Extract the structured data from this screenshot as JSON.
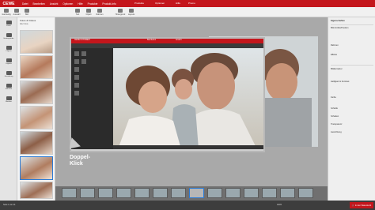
{
  "app": {
    "logo": "CEWE"
  },
  "menubar": {
    "items": [
      "Datei",
      "Bearbeiten",
      "Ansicht",
      "Optionen",
      "Hilfe",
      "Produkte",
      "Produkt-Info"
    ],
    "right_items": [
      "Produkte",
      "Optionen",
      "Hilfe",
      "Promo"
    ]
  },
  "toolbar": {
    "buttons": [
      "Ganzseitig",
      "Auswahl",
      "Bild",
      "Text",
      "Clipart",
      "Rahmen",
      "Hintergrund",
      "Layouts",
      "Fotos & Videos"
    ]
  },
  "rail": {
    "items": [
      "Fotos",
      "Hintergründe",
      "Cliparts",
      "Layouts",
      "Gestaltung",
      "Rahmen",
      "Masken"
    ]
  },
  "photos_panel": {
    "title": "Fotos & Videos",
    "subtitle": "Alle Fotos"
  },
  "popup": {
    "title": "CEWE FOTOWELT",
    "tabs": [
      "Bearbeiten",
      "Ansicht"
    ]
  },
  "callout": {
    "line1": "Doppel-",
    "line2": "Klick"
  },
  "props": {
    "title": "Eigenschaften",
    "rows": [
      "Bild-Größe/Position",
      "Rahmen",
      "Effekte",
      "Bildkorrektur",
      "Helligkeit & Kontrast",
      "Farbe",
      "Schärfe",
      "Schatten",
      "Transparenz",
      "Ausrichtung"
    ]
  },
  "statusbar": {
    "left": "Seite 1 von 24",
    "zoom": "100%",
    "cart": "In den Warenkorb"
  },
  "colors": {
    "brand_red": "#c4161c",
    "workspace": "#a9a9a9",
    "statusbar": "#3d3d3d"
  },
  "icons": [
    "folder-icon",
    "image-icon",
    "text-icon",
    "cart-icon"
  ]
}
